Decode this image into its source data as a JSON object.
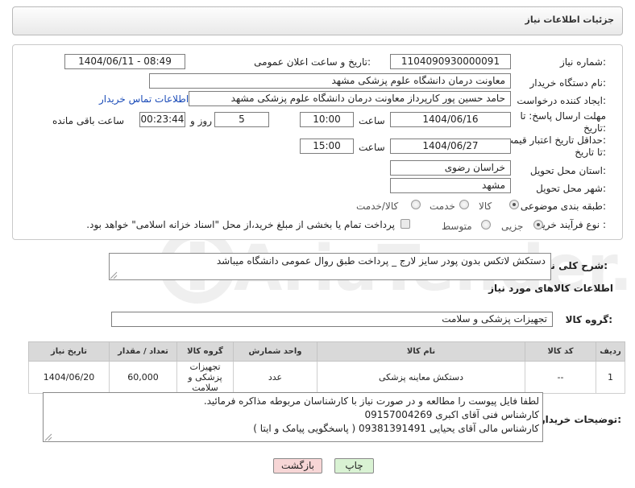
{
  "header": {
    "title": "جزئیات اطلاعات نیاز"
  },
  "form": {
    "need_number": {
      "label": "شماره نیاز:",
      "value": "1104090930000091"
    },
    "announce_datetime": {
      "label": "تاریخ و ساعت اعلان عمومی:",
      "value": "1404/06/11 - 08:49"
    },
    "buyer_org": {
      "label": "نام دستگاه خریدار:",
      "value": "معاونت درمان دانشگاه علوم پزشکی مشهد"
    },
    "requester": {
      "label": "ایجاد کننده درخواست:",
      "value": "حامد حسین پور کارپرداز معاونت درمان دانشگاه علوم پزشکی مشهد",
      "contact_link": "اطلاعات تماس خریدار"
    },
    "reply_deadline": {
      "label_line1": "مهلت ارسال پاسخ: تا",
      "label_line2": "تاریخ:",
      "date": "1404/06/16",
      "time_label": "ساعت",
      "time": "10:00",
      "days": "5",
      "days_label": "روز و",
      "remaining": "00:23:44",
      "remaining_label": "ساعت باقی مانده"
    },
    "price_validity": {
      "label_line1": "حداقل تاریخ اعتبار قیمت:",
      "label_line2": "تا تاریخ:",
      "date": "1404/06/27",
      "time_label": "ساعت",
      "time": "15:00"
    },
    "delivery_province": {
      "label": "استان محل تحویل:",
      "value": "خراسان رضوی"
    },
    "delivery_city": {
      "label": "شهر محل تحویل:",
      "value": "مشهد"
    },
    "category": {
      "label": "طبقه بندی موضوعی:",
      "options": [
        "کالا",
        "خدمت",
        "کالا/خدمت"
      ],
      "selected": "کالا"
    },
    "process": {
      "label": "نوع فرآیند خرید :",
      "options": [
        "جزیی",
        "متوسط"
      ],
      "selected": "جزیی",
      "note": "پرداخت تمام یا بخشی از مبلغ خرید،از محل \"اسناد خزانه اسلامی\" خواهد بود."
    }
  },
  "description": {
    "label": "شرح کلی نیاز:",
    "value": "دستکش لاتکس بدون پودر سایز لارج _ پرداخت طبق روال عمومی دانشگاه  میباشد"
  },
  "goods_info": {
    "title": "اطلاعات کالاهای مورد نیاز"
  },
  "goods_group": {
    "label": "گروه کالا:",
    "value": "تجهیزات پزشکی و سلامت"
  },
  "table": {
    "headers": [
      "ردیف",
      "کد کالا",
      "نام کالا",
      "واحد شمارش",
      "گروه کالا",
      "تعداد / مقدار",
      "تاریخ نیاز"
    ],
    "rows": [
      {
        "index": "1",
        "code": "--",
        "name": "دستکش معاینه پزشکی",
        "unit": "عدد",
        "group": "تجهیزات پزشکی و سلامت",
        "qty": "60,000",
        "date": "1404/06/20"
      }
    ]
  },
  "buyer_notes": {
    "label": "توضیحات خریدار:",
    "lines": [
      "لطفا فایل پیوست را مطالعه و در صورت نیاز با کارشناسان مربوطه مذاکره فرمائید.",
      "کارشناس فنی آقای اکبری 09157004269",
      "کارشناس مالی آقای  یحیایی 09381391491 ( پاسخگویی پیامک و ایتا )"
    ]
  },
  "buttons": {
    "print": "چاپ",
    "back": "بازگشت"
  },
  "watermark": {
    "text": "AriaTender.net"
  },
  "colors": {
    "link": "#1a4bb8",
    "print_button": "#d9f2d3",
    "back_button": "#f7d6d6",
    "header_gradient_end": "#e9e9e9"
  }
}
